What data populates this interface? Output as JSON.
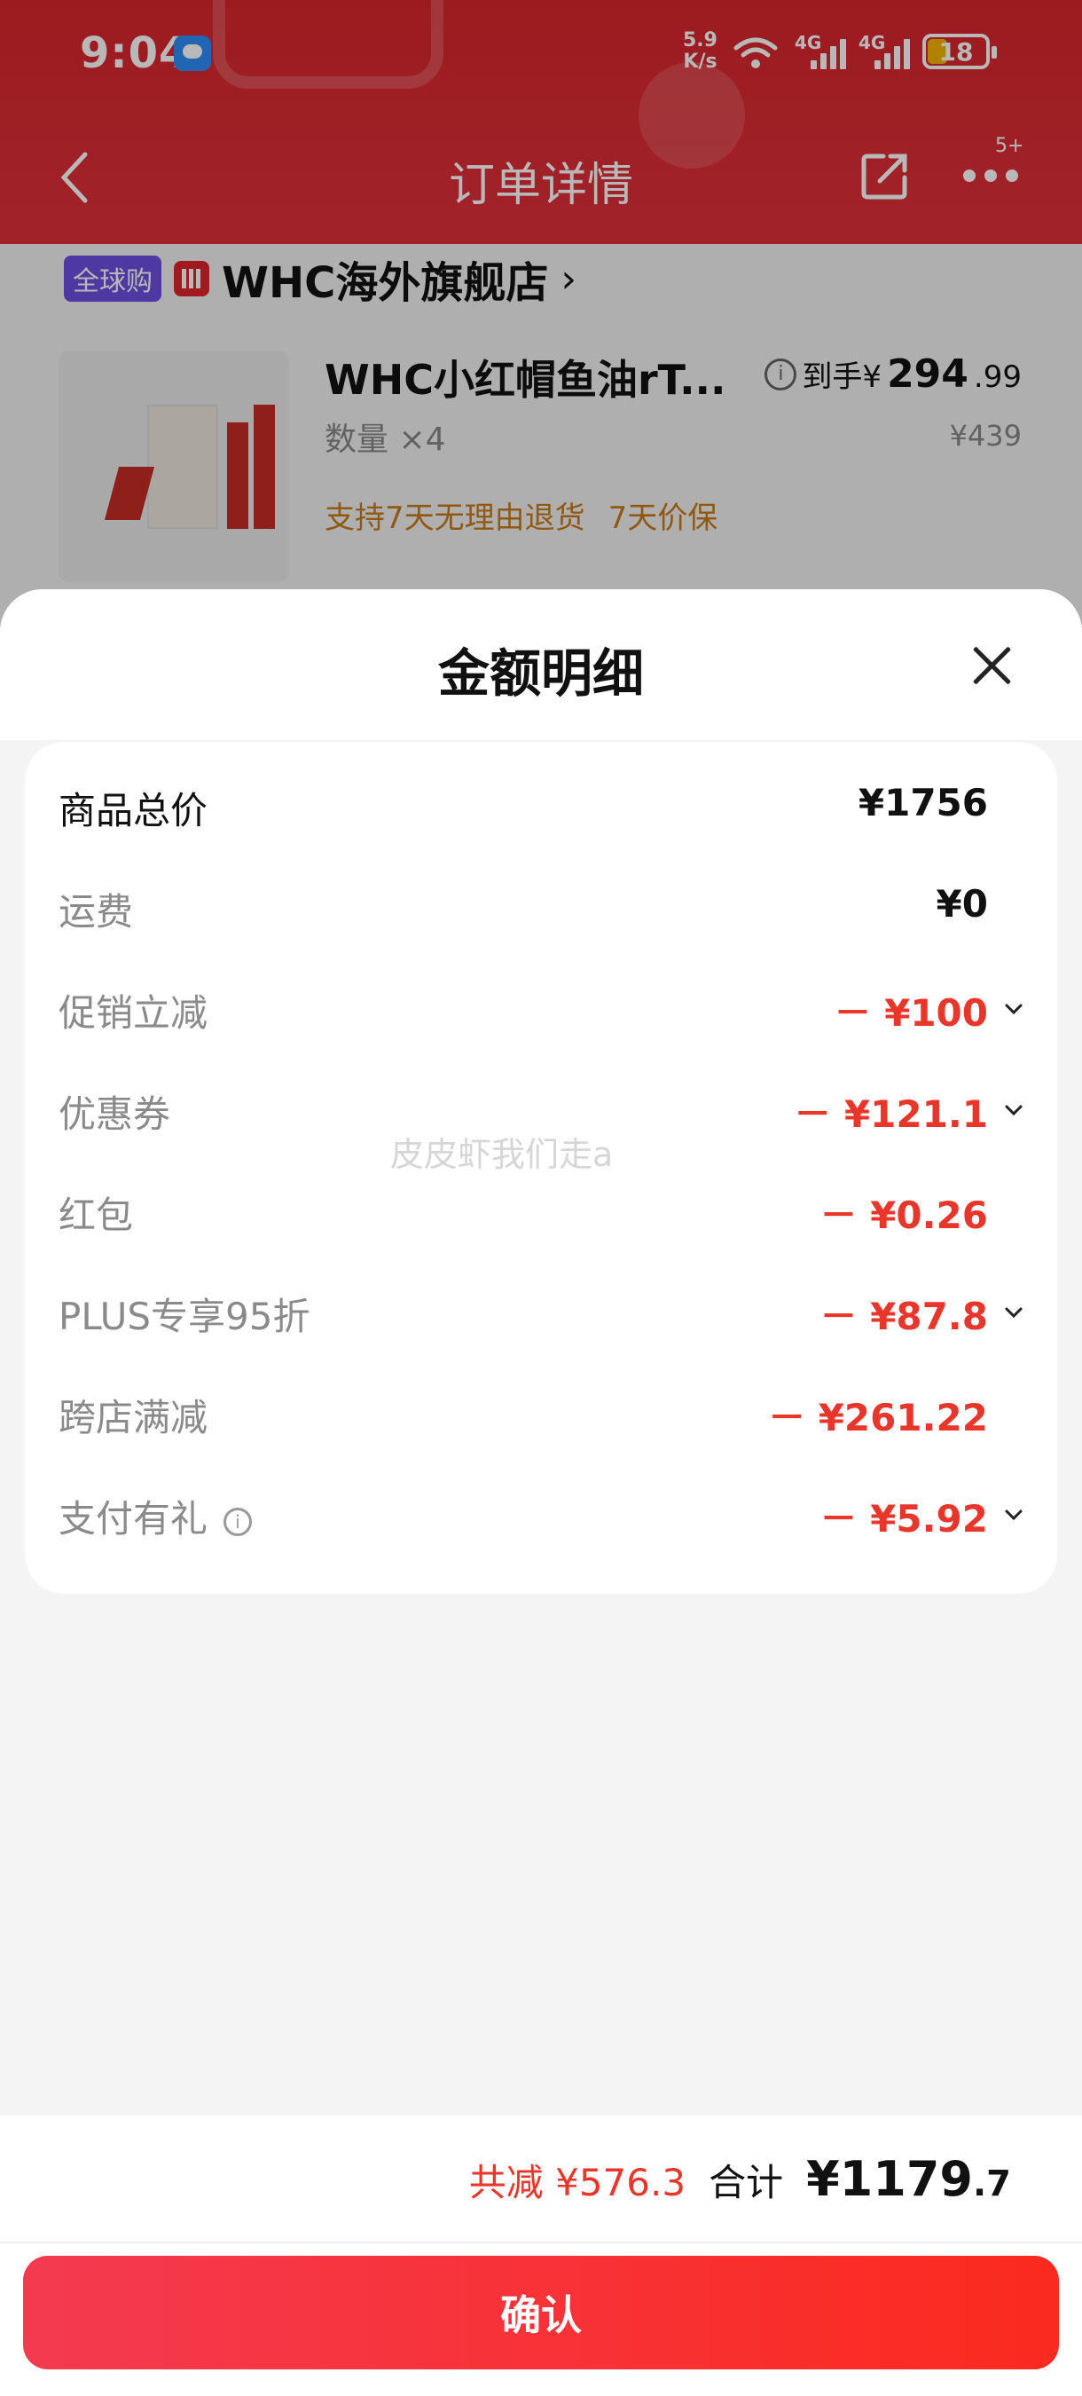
{
  "status_bar": {
    "time": "9:04",
    "net_speed_top": "5.9",
    "net_speed_bottom": "K/s",
    "sim1": "4G",
    "sim2": "4G",
    "battery": "18"
  },
  "navbar": {
    "title": "订单详情",
    "badge": "5+"
  },
  "shop": {
    "tag": "全球购",
    "name": "WHC海外旗舰店",
    "chevron": "›"
  },
  "product": {
    "name": "WHC小红帽鱼油rT...",
    "price_prefix": "到手¥",
    "price_main": "294",
    "price_decimal": ".99",
    "quantity": "数量 ×4",
    "original_price": "¥439",
    "tags": [
      "支持7天无理由退货",
      "7天价保"
    ]
  },
  "sheet": {
    "title": "金额明细",
    "rows": [
      {
        "label": "商品总价",
        "amount": "¥1756"
      },
      {
        "label": "运费",
        "amount": "¥0"
      },
      {
        "label": "促销立减",
        "amount": "－ ¥100"
      },
      {
        "label": "优惠券",
        "amount": "－ ¥121.1"
      },
      {
        "label": "红包",
        "amount": "－ ¥0.26"
      },
      {
        "label": "PLUS专享95折",
        "amount": "－ ¥87.8"
      },
      {
        "label": "跨店满减",
        "amount": "－ ¥261.22"
      },
      {
        "label": "支付有礼",
        "amount": "－ ¥5.92"
      }
    ],
    "info_glyph": "i",
    "watermark": "皮皮虾我们走a"
  },
  "footer": {
    "saved": "共减 ¥576.3",
    "total_label": "合计",
    "total_currency": "¥",
    "total_int": "1179",
    "total_dec": ".7",
    "confirm_label": "确认"
  },
  "colors": {
    "accent_red": "#e8362b",
    "header_red": "#d8262c",
    "global_purple": "#6c4ee0",
    "tag_orange": "#c97a18"
  }
}
